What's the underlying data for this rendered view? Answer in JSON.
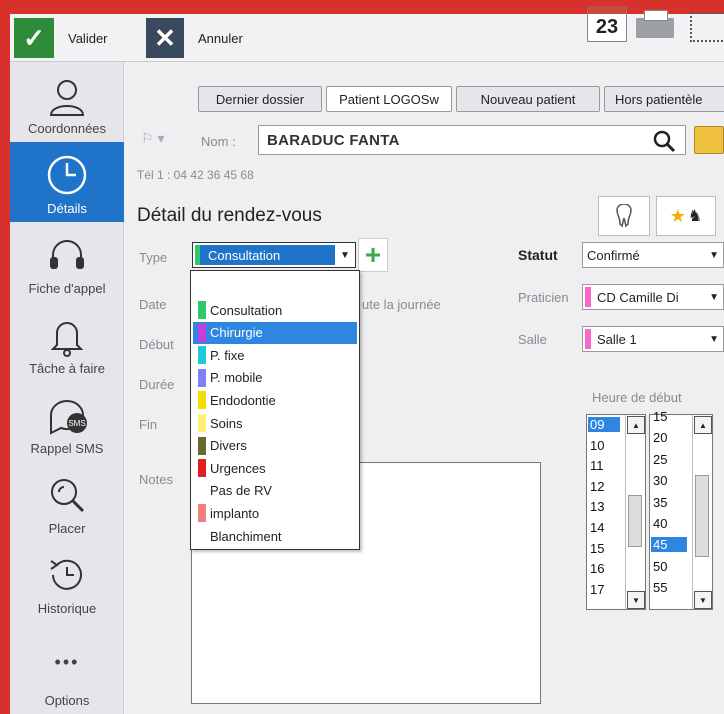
{
  "toolbar": {
    "validate_label": "Valider",
    "cancel_label": "Annuler",
    "calendar_day": "23",
    "icons": {
      "validate": "check-icon",
      "cancel": "close-icon",
      "calendar": "calendar-icon",
      "print": "printer-icon",
      "screen": "screen-icon"
    },
    "colors": {
      "validate_bg": "#2e8b3a",
      "cancel_bg": "#3a4a5e"
    }
  },
  "sidebar": {
    "items": [
      {
        "label": "Coordonnées",
        "icon": "person-icon"
      },
      {
        "label": "Détails",
        "icon": "clock-icon",
        "active": true
      },
      {
        "label": "Fiche d'appel",
        "icon": "headset-icon"
      },
      {
        "label": "Tâche à faire",
        "icon": "bell-icon"
      },
      {
        "label": "Rappel SMS",
        "icon": "sms-icon",
        "badge": "SMS"
      },
      {
        "label": "Placer",
        "icon": "search-icon"
      },
      {
        "label": "Historique",
        "icon": "history-icon"
      },
      {
        "label": "Options",
        "icon": "more-icon",
        "glyph": "•••"
      }
    ],
    "active_color": "#1f73c9"
  },
  "tabs": [
    {
      "label": "Dernier dossier"
    },
    {
      "label": "Patient LOGOSw",
      "active": true
    },
    {
      "label": "Nouveau patient"
    },
    {
      "label": "Hors patientèle"
    }
  ],
  "patient": {
    "name_label": "Nom :",
    "name_value": "BARADUC FANTA",
    "phone": "Tél 1 : 04 42 36 45 68"
  },
  "details": {
    "title": "Détail du rendez-vous",
    "labels": {
      "type": "Type",
      "date": "Date",
      "debut": "Début",
      "duree": "Durée",
      "fin": "Fin",
      "notes": "Notes"
    },
    "type_selected": "Consultation",
    "all_day_partial": "ute la journée",
    "statut_label": "Statut",
    "statut_value": "Confirmé",
    "praticien_label": "Praticien",
    "praticien_value": "CD  Camille Di",
    "salle_label": "Salle",
    "salle_value": "Salle 1",
    "heure_label": "Heure de début"
  },
  "type_options": [
    {
      "label": "Consultation",
      "color": "#2fc86a"
    },
    {
      "label": "Chirurgie",
      "color": "#c040e0",
      "highlighted": true
    },
    {
      "label": "P. fixe",
      "color": "#20c8d8"
    },
    {
      "label": "P. mobile",
      "color": "#8080f0"
    },
    {
      "label": "Endodontie",
      "color": "#f0e000"
    },
    {
      "label": "Soins",
      "color": "#fff080"
    },
    {
      "label": "Divers",
      "color": "#6a6a30"
    },
    {
      "label": "Urgences",
      "color": "#e02020"
    },
    {
      "label": "Pas de RV",
      "color": ""
    },
    {
      "label": "implanto",
      "color": "#f08080"
    },
    {
      "label": "Blanchiment",
      "color": ""
    }
  ],
  "hours": [
    "09",
    "10",
    "11",
    "12",
    "13",
    "14",
    "15",
    "16",
    "17"
  ],
  "hours_selected": "09",
  "minutes": [
    "15",
    "20",
    "25",
    "30",
    "35",
    "40",
    "45",
    "50",
    "55"
  ],
  "minutes_selected": "45"
}
